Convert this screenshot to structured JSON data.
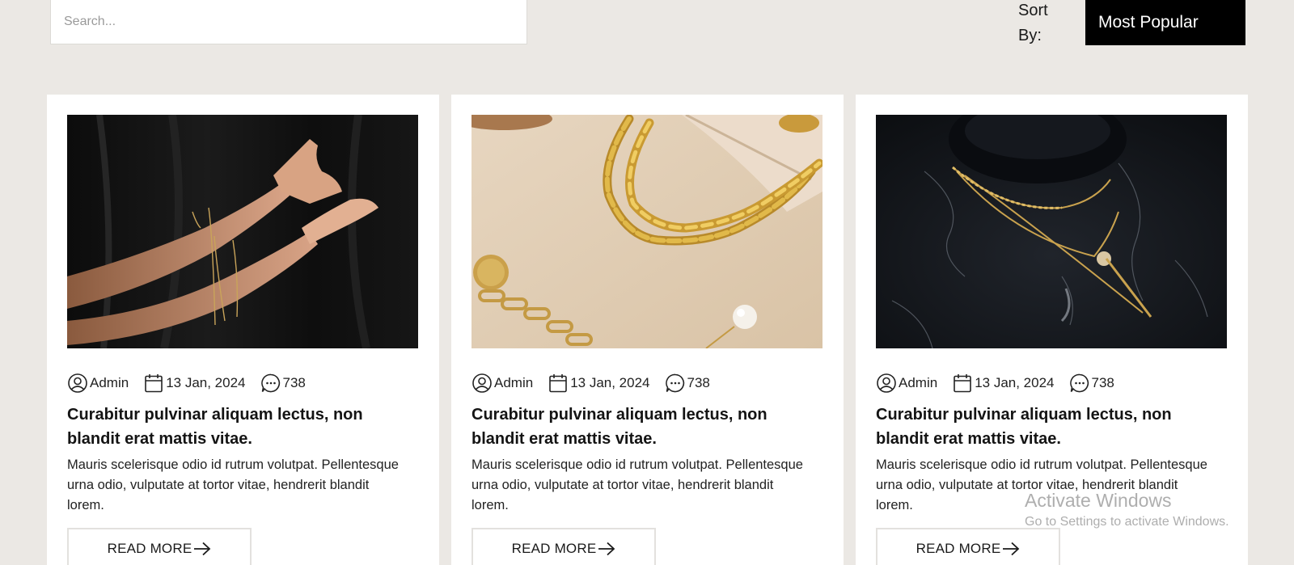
{
  "search": {
    "placeholder": "Search..."
  },
  "sort": {
    "label": "Sort By:",
    "selected": "Most Popular"
  },
  "posts": [
    {
      "image": "woman-arms-gold-bracelets-photo",
      "author": "Admin",
      "date": "13 Jan, 2024",
      "comments": "738",
      "title": "Curabitur pulvinar aliquam lectus, non blandit erat mattis vitae.",
      "excerpt": "Mauris scelerisque odio id rutrum volutpat. Pellentesque urna odio, vulputate at tortor vitae, hendrerit blandit lorem.",
      "button": "READ MORE"
    },
    {
      "image": "gold-chain-bracelet-linen-photo",
      "author": "Admin",
      "date": "13 Jan, 2024",
      "comments": "738",
      "title": "Curabitur pulvinar aliquam lectus, non blandit erat mattis vitae.",
      "excerpt": "Mauris scelerisque odio id rutrum volutpat. Pellentesque urna odio, vulputate at tortor vitae, hendrerit blandit lorem.",
      "button": "READ MORE"
    },
    {
      "image": "layered-gold-necklace-marble-photo",
      "author": "Admin",
      "date": "13 Jan, 2024",
      "comments": "738",
      "title": "Curabitur pulvinar aliquam lectus, non blandit erat mattis vitae.",
      "excerpt": "Mauris scelerisque odio id rutrum volutpat. Pellentesque urna odio, vulputate at tortor vitae, hendrerit blandit lorem.",
      "button": "READ MORE"
    }
  ],
  "icons": {
    "author": "user-circle-icon",
    "date": "calendar-icon",
    "comments": "chat-bubble-icon",
    "read_more": "arrow-right-icon"
  },
  "colors": {
    "page_background": "#ebe8e4",
    "card_background": "#ffffff",
    "sort_background": "#000000",
    "text": "#1a1a1a"
  },
  "watermark": {
    "line1": "Activate Windows",
    "line2": "Go to Settings to activate Windows."
  }
}
